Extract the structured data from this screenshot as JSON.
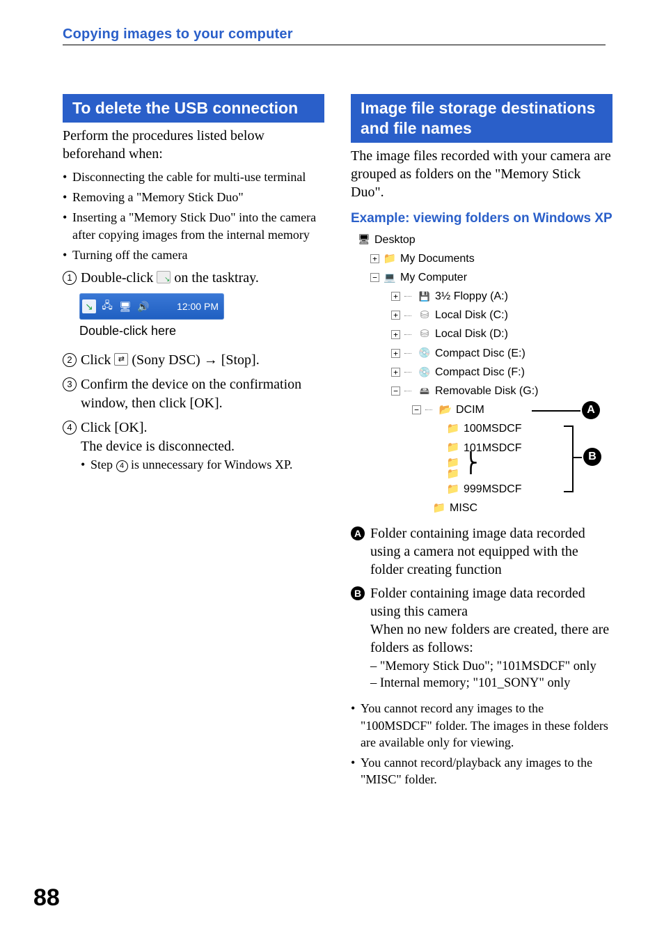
{
  "running_head": "Copying images to your computer",
  "page_number": "88",
  "left": {
    "section_title": "To delete the USB connection",
    "intro": "Perform the procedures listed below beforehand when:",
    "when": [
      "Disconnecting the cable for multi-use terminal",
      "Removing a \"Memory Stick Duo\"",
      "Inserting a \"Memory Stick Duo\" into the camera after copying images from the internal memory",
      "Turning off the camera"
    ],
    "step1_pre": "Double-click ",
    "step1_post": " on the tasktray.",
    "tasktray": {
      "time": "12:00 PM"
    },
    "caption1": "Double-click here",
    "step2_pre": "Click ",
    "step2_mid": " (Sony DSC) ",
    "step2_arrow": "→",
    "step2_post": " [Stop].",
    "step3": "Confirm the device on the confirmation window, then click [OK].",
    "step4_line1": "Click [OK].",
    "step4_line2": "The device is disconnected.",
    "step4_note_pre": "Step ",
    "step4_note_post": " is unnecessary for Windows XP.",
    "circled4_inline": "4"
  },
  "right": {
    "section_title": "Image file storage destinations and file names",
    "intro": "The image files recorded with your camera are grouped as folders on the \"Memory Stick Duo\".",
    "subhead": "Example: viewing folders on Windows XP",
    "tree": {
      "desktop": "Desktop",
      "mydocs": "My Documents",
      "mycomp": "My Computer",
      "floppy": "3½ Floppy (A:)",
      "c": "Local Disk (C:)",
      "d": "Local Disk (D:)",
      "e": "Compact Disc (E:)",
      "f": "Compact Disc (F:)",
      "g": "Removable Disk (G:)",
      "dcim": "DCIM",
      "f100": "100MSDCF",
      "f101": "101MSDCF",
      "f999": "999MSDCF",
      "misc": "MISC"
    },
    "callout_A": "A",
    "callout_B": "B",
    "defs": {
      "A": "Folder containing image data recorded using a camera not equipped with the folder creating function",
      "B_line1": "Folder containing image data recorded using this camera",
      "B_line2": "When no new folders are created, there are folders as follows:",
      "B_sub": [
        "\"Memory Stick Duo\"; \"101MSDCF\" only",
        "Internal memory; \"101_SONY\" only"
      ]
    },
    "tail_bullets": [
      "You cannot record any images to the \"100MSDCF\" folder. The images in these folders are available only for viewing.",
      "You cannot record/playback any images to the \"MISC\" folder."
    ]
  }
}
